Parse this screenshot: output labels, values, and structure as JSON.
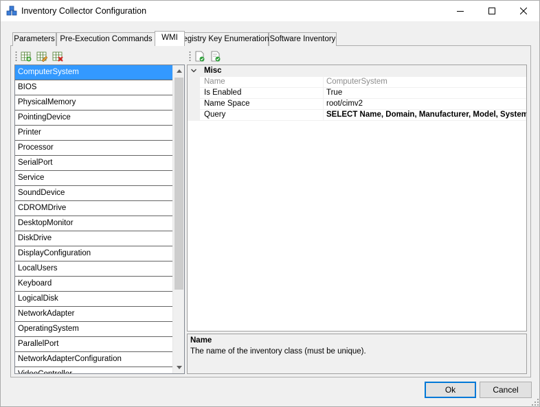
{
  "window": {
    "title": "Inventory Collector Configuration"
  },
  "tabs": [
    {
      "label": "Parameters",
      "active": false
    },
    {
      "label": "Pre-Execution Commands",
      "active": false
    },
    {
      "label": "WMI",
      "active": true
    },
    {
      "label": "Registry Key Enumeration",
      "active": false
    },
    {
      "label": "Software Inventory",
      "active": false
    }
  ],
  "left_toolbar": {
    "icons": [
      "add-class-icon",
      "edit-class-icon",
      "delete-class-icon"
    ]
  },
  "classes": {
    "selected": "ComputerSystem",
    "items": [
      "ComputerSystem",
      "BIOS",
      "PhysicalMemory",
      "PointingDevice",
      "Printer",
      "Processor",
      "SerialPort",
      "Service",
      "SoundDevice",
      "CDROMDrive",
      "DesktopMonitor",
      "DiskDrive",
      "DisplayConfiguration",
      "LocalUsers",
      "Keyboard",
      "LogicalDisk",
      "NetworkAdapter",
      "OperatingSystem",
      "ParallelPort",
      "NetworkAdapterConfiguration",
      "VideoController"
    ]
  },
  "right_toolbar": {
    "icons": [
      "validate-query-icon",
      "test-query-icon"
    ]
  },
  "property_grid": {
    "category": "Misc",
    "rows": [
      {
        "name": "Name",
        "value": "ComputerSystem",
        "readonly": true,
        "bold": false
      },
      {
        "name": "Is Enabled",
        "value": "True",
        "readonly": false,
        "bold": false
      },
      {
        "name": "Name Space",
        "value": "root/cimv2",
        "readonly": false,
        "bold": false
      },
      {
        "name": "Query",
        "value": "SELECT Name, Domain, Manufacturer, Model, SystemType",
        "readonly": false,
        "bold": true
      }
    ]
  },
  "help": {
    "title": "Name",
    "description": "The name of the inventory class (must be unique)."
  },
  "buttons": {
    "ok": "Ok",
    "cancel": "Cancel"
  },
  "colors": {
    "selection": "#3399ff",
    "accent": "#0078d7"
  }
}
